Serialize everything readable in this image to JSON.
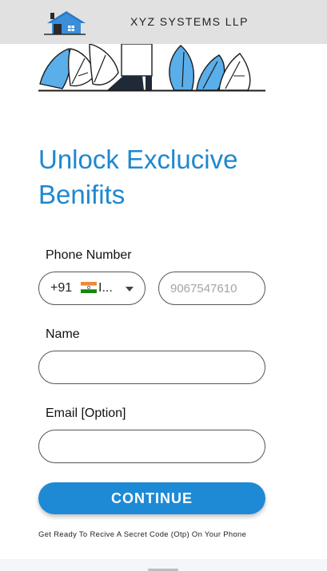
{
  "header": {
    "brand": "XYZ SYSTEMS LLP",
    "logo_icon": "house-logo-icon"
  },
  "hero": {
    "illustration": "leaves-illustration"
  },
  "form": {
    "title": "Unlock Exclucive Benifits",
    "phone_label": "Phone Number",
    "country_code": "+91",
    "country_flag": "india-flag-icon",
    "country_truncated": "I...",
    "phone_placeholder": "9067547610",
    "name_label": "Name",
    "name_value": "",
    "email_label": "Email [Option]",
    "email_value": "",
    "continue_label": "CONTINUE",
    "note": "Get Ready To Recive A Secret Code (Otp) On Your Phone"
  },
  "colors": {
    "accent": "#1e88cf",
    "button": "#1e8ad6",
    "header_bg": "#e1e1e1",
    "leaf": "#5aaee9"
  }
}
